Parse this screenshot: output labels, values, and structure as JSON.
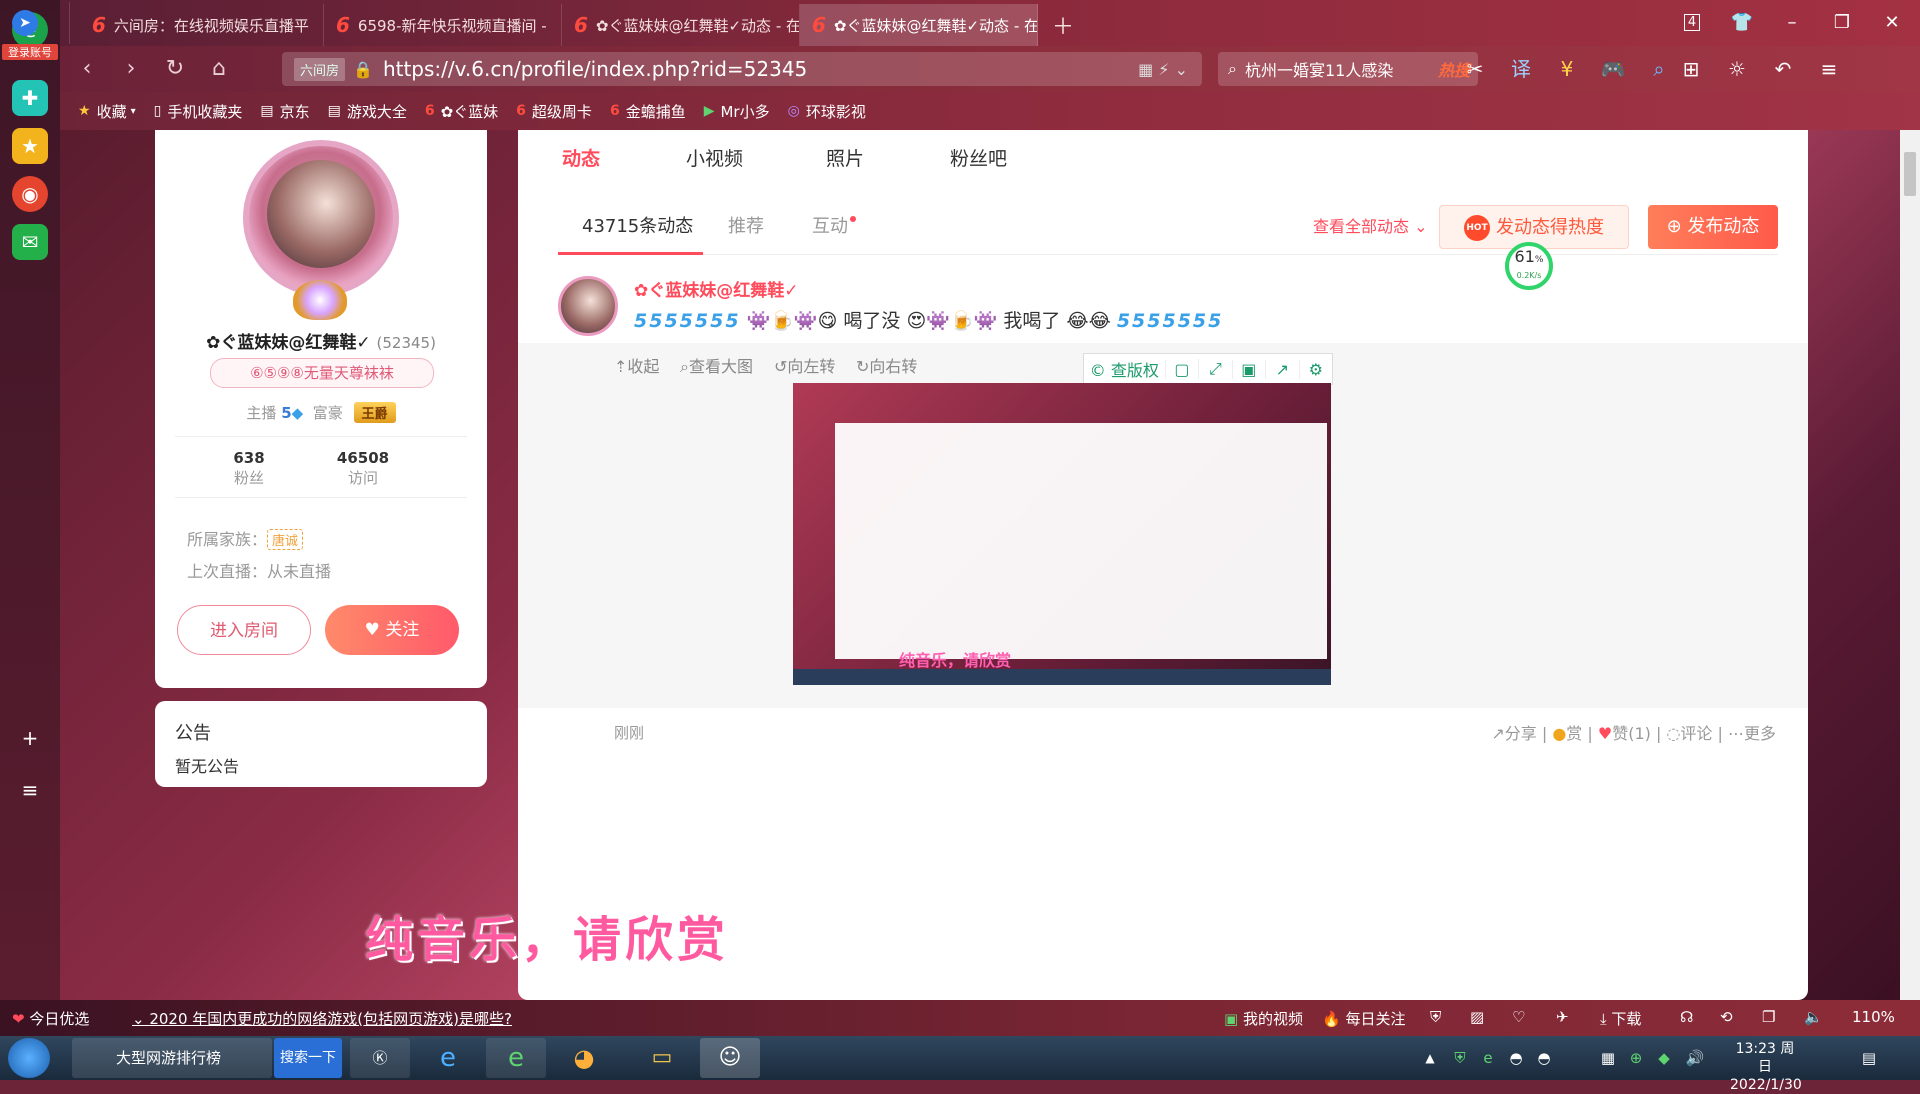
{
  "browser": {
    "sidebar_login": "登录账号",
    "tabs": [
      {
        "title": "六间房：在线视频娱乐直播平",
        "active": false
      },
      {
        "title": "6598-新年快乐视频直播间 -",
        "active": false
      },
      {
        "title": "✿ぐ蓝妹妹@红舞鞋✓动态 - 在",
        "active": false
      },
      {
        "title": "✿ぐ蓝妹妹@红舞鞋✓动态 - 在",
        "active": true
      }
    ],
    "tab_count": "4",
    "url_site_badge": "六间房",
    "url": "https://v.6.cn/profile/index.php?rid=52345",
    "search_text": "杭州一婚宴11人感染",
    "search_hot": "热搜",
    "bookmarks": [
      "收藏",
      "手机收藏夹",
      "京东",
      "游戏大全",
      "✿ぐ蓝妹",
      "超级周卡",
      "金蟾捕鱼",
      "Mr小多",
      "环球影视"
    ]
  },
  "profile": {
    "nickname": "✿ぐ蓝妹妹@红舞鞋✓",
    "rid": "(52345)",
    "family_badge": "⑥⑤⑨⑧无量天尊袜袜",
    "anchor_label": "主播",
    "anchor_level": "5",
    "rich_label": "富豪",
    "rich_title": "王爵",
    "fans_count": "638",
    "fans_label": "粉丝",
    "visits_count": "46508",
    "visits_label": "访问",
    "family_label": "所属家族：",
    "family_name": "唐诚",
    "last_live": "上次直播：从未直播",
    "enter_room": "进入房间",
    "follow": "关注"
  },
  "notice": {
    "title": "公告",
    "body": "暂无公告"
  },
  "page_tabs": [
    "动态",
    "小视频",
    "照片",
    "粉丝吧"
  ],
  "feed": {
    "tabs": [
      "43715条动态",
      "推荐",
      "互动"
    ],
    "view_all": "查看全部动态",
    "hot_button": "发动态得热度",
    "hot_logo": "HOT",
    "post_button": "发布动态",
    "post": {
      "author": "✿ぐ蓝妹妹@红舞鞋✓",
      "text_prefix": "5555555",
      "text_mid": "喝了没",
      "text_mid2": "我喝了",
      "text_suffix": "5555555",
      "tools": [
        "收起",
        "查看大图",
        "向左转",
        "向右转"
      ],
      "copyright": "查版权",
      "thumb_caption": "纯音乐，请欣赏",
      "time": "刚刚",
      "actions": [
        "分享",
        "赏",
        "赞(1)",
        "评论",
        "更多"
      ]
    }
  },
  "overlay_caption": "纯音乐，请欣赏",
  "speed_widget": {
    "percent": "61",
    "unit": "%",
    "rate": "0.2K/s"
  },
  "statusbar": {
    "today": "今日优选",
    "headline": "2020 年国内更成功的网络游戏(包括网页游戏)是哪些?",
    "my_video": "我的视频",
    "daily": "每日关注",
    "download": "下载",
    "zoom": "110%"
  },
  "taskbar": {
    "ie_item": "大型网游排行榜",
    "search_btn": "搜索一下",
    "time": "13:23 周日",
    "date": "2022/1/30"
  }
}
